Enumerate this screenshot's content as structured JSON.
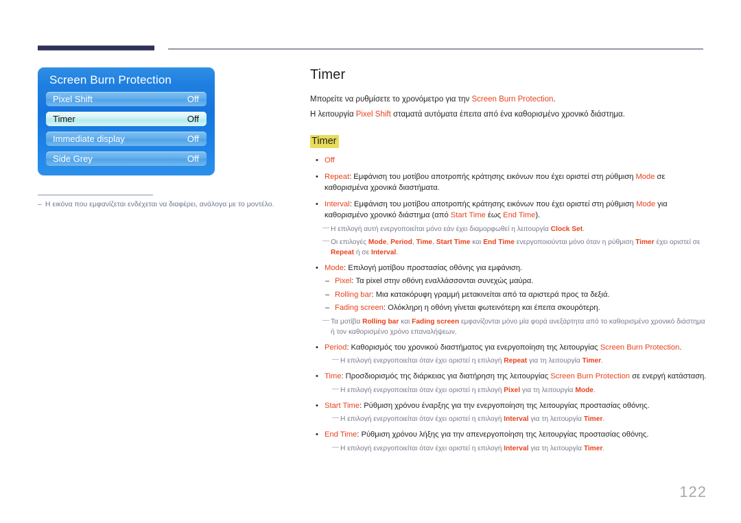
{
  "page": {
    "number": "122",
    "title": "Timer",
    "subheading": "Timer"
  },
  "header": {
    "accent_color": "#2e3055",
    "rule_color": "#3a3a52"
  },
  "colors": {
    "keyword": "#e8411c",
    "highlight": "#e8dc5a",
    "osd_panel_blue": "#1f7fe0",
    "osd_row_blue": "#63aeeb",
    "osd_row_selected": "#b4ecef",
    "note_gray": "#77798c"
  },
  "osd": {
    "title": "Screen Burn Protection",
    "rows": [
      {
        "label": "Pixel Shift",
        "value": "Off",
        "selected": false
      },
      {
        "label": "Timer",
        "value": "Off",
        "selected": true
      },
      {
        "label": "Immediate display",
        "value": "Off",
        "selected": false
      },
      {
        "label": "Side Grey",
        "value": "Off",
        "selected": false
      }
    ],
    "note_dash": "–",
    "note": "Η εικόνα που εμφανίζεται ενδέχεται να διαφέρει, ανάλογα με το μοντέλο."
  },
  "intro": {
    "line1_a": "Μπορείτε να ρυθμίσετε το χρονόμετρο για την ",
    "line1_kw": "Screen Burn Protection",
    "line1_b": ".",
    "line2_a": "Η λειτουργία ",
    "line2_kw": "Pixel Shift",
    "line2_b": " σταματά αυτόματα έπειτα από ένα καθορισμένο χρονικό διάστημα."
  },
  "markers": {
    "bullet": "•",
    "dash": "–",
    "note": "—"
  },
  "items": {
    "off": {
      "kw": "Off"
    },
    "repeat": {
      "kw": "Repeat",
      "text": ": Εμφάνιση του μοτίβου αποτροπής κράτησης εικόνων που έχει οριστεί στη ρύθμιση ",
      "kw2": "Mode",
      "text2": " σε καθορισμένα χρονικά διαστήματα."
    },
    "interval": {
      "kw": "Interval",
      "text": ": Εμφάνιση του μοτίβου αποτροπής κράτησης εικόνων που έχει οριστεί στη ρύθμιση ",
      "kw2": "Mode",
      "text2": " για καθορισμένο χρονικό διάστημα (από ",
      "kw3": "Start Time",
      "text3": " έως ",
      "kw4": "End Time",
      "text4": ")."
    },
    "note_clock": {
      "text": "Η επιλογή αυτή ενεργοποιείται μόνο εάν έχει διαμορφωθεί η λειτουργία ",
      "kw": "Clock Set",
      "text2": "."
    },
    "note_options": {
      "text": "Οι επιλογές ",
      "kw1": "Mode",
      "sep1": ", ",
      "kw2": "Period",
      "sep2": ", ",
      "kw3": "Time",
      "sep3": ", ",
      "kw4": "Start Time",
      "sep4": " και ",
      "kw5": "End Time",
      "text2": " ενεργοποιούνται μόνο όταν η ρύθμιση ",
      "kw6": "Timer",
      "text3": " έχει οριστεί σε ",
      "kw7": "Repeat",
      "text4": " ή σε ",
      "kw8": "Interval",
      "text5": "."
    },
    "mode": {
      "kw": "Mode",
      "text": ": Επιλογή μοτίβου προστασίας οθόνης για εμφάνιση."
    },
    "pixel": {
      "kw": "Pixel",
      "text": ": Τα pixel στην οθόνη εναλλάσσονται συνεχώς μαύρα."
    },
    "rolling_bar": {
      "kw": "Rolling bar",
      "text": ": Μια κατακόρυφη γραμμή μετακινείται από τα αριστερά προς τα δεξιά."
    },
    "fading_screen": {
      "kw": "Fading screen",
      "text": ": Ολόκληρη η οθόνη γίνεται φωτεινότερη και έπειτα σκουρότερη."
    },
    "note_patterns": {
      "text": "Τα μοτίβα ",
      "kw1": "Rolling bar",
      "text2": " και ",
      "kw2": "Fading screen",
      "text3": " εμφανίζονται μόνο μία φορά ανεξάρτητα από το καθορισμένο χρονικό διάστημα ή τον καθορισμένο χρόνο επαναλήψεων."
    },
    "period": {
      "kw": "Period",
      "text": ": Καθορισμός του χρονικού διαστήματος για ενεργοποίηση της λειτουργίας ",
      "kw2": "Screen Burn Protection",
      "text2": "."
    },
    "note_period": {
      "text": "Η επιλογή ενεργοποιείται όταν έχει οριστεί η επιλογή ",
      "kw1": "Repeat",
      "text2": " για τη λειτουργία ",
      "kw2": "Timer",
      "text3": "."
    },
    "time": {
      "kw": "Time",
      "text": ": Προσδιορισμός της διάρκειας για διατήρηση της λειτουργίας ",
      "kw2": "Screen Burn Protection",
      "text2": " σε ενεργή κατάσταση."
    },
    "note_time": {
      "text": "Η επιλογή ενεργοποιείται όταν έχει οριστεί η επιλογή ",
      "kw1": "Pixel",
      "text2": " για τη λειτουργία ",
      "kw2": "Mode",
      "text3": "."
    },
    "start_time": {
      "kw": "Start Time",
      "text": ": Ρύθμιση χρόνου έναρξης για την ενεργοποίηση της λειτουργίας προστασίας οθόνης."
    },
    "note_start": {
      "text": "Η επιλογή ενεργοποιείται όταν έχει οριστεί η επιλογή ",
      "kw1": "Interval",
      "text2": " για τη λειτουργία ",
      "kw2": "Timer",
      "text3": "."
    },
    "end_time": {
      "kw": "End Time",
      "text": ": Ρύθμιση χρόνου λήξης για την απενεργοποίηση της λειτουργίας προστασίας οθόνης."
    },
    "note_end": {
      "text": "Η επιλογή ενεργοποιείται όταν έχει οριστεί η επιλογή ",
      "kw1": "Interval",
      "text2": " για τη λειτουργία ",
      "kw2": "Timer",
      "text3": "."
    }
  }
}
